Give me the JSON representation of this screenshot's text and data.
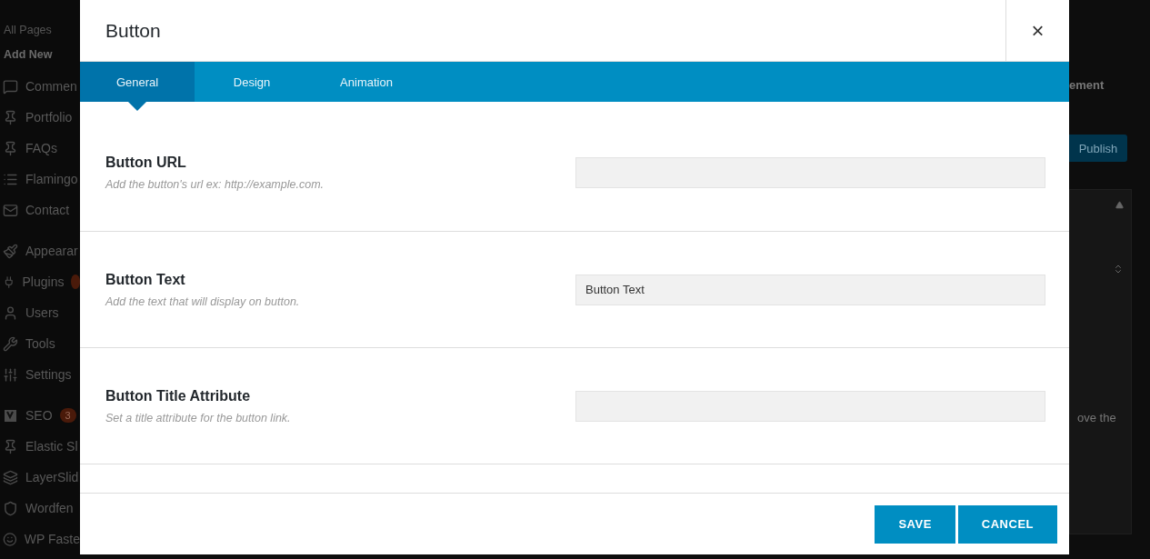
{
  "sidebar": {
    "submenu": [
      {
        "label": "All Pages",
        "current": false
      },
      {
        "label": "Add New",
        "current": true
      }
    ],
    "items": [
      {
        "label": "Commen"
      },
      {
        "label": "Portfolio"
      },
      {
        "label": "FAQs"
      },
      {
        "label": "Flamingo"
      },
      {
        "label": "Contact"
      },
      {
        "label": "Appearar"
      },
      {
        "label": "Plugins"
      },
      {
        "label": "Users"
      },
      {
        "label": "Tools"
      },
      {
        "label": "Settings"
      },
      {
        "label": "SEO",
        "badge": "3"
      },
      {
        "label": "Elastic Sl"
      },
      {
        "label": "LayerSlid"
      },
      {
        "label": "Wordfen"
      },
      {
        "label": "WP Faste"
      }
    ]
  },
  "right_panel": {
    "heading": "ement",
    "publish_button": "Publish",
    "text": "ove the"
  },
  "modal": {
    "title": "Button",
    "close": "×",
    "tabs": [
      {
        "label": "General",
        "selected": true
      },
      {
        "label": "Design",
        "selected": false
      },
      {
        "label": "Animation",
        "selected": false
      }
    ],
    "fields": [
      {
        "label": "Button URL",
        "description": "Add the button's url ex: http://example.com."
      },
      {
        "label": "Button Text",
        "description": "Add the text that will display on button.",
        "value": "Button Text"
      },
      {
        "label": "Button Title Attribute",
        "description": "Set a title attribute for the button link."
      }
    ],
    "buttons": [
      {
        "label": "SAVE"
      },
      {
        "label": "CANCEL"
      }
    ]
  }
}
